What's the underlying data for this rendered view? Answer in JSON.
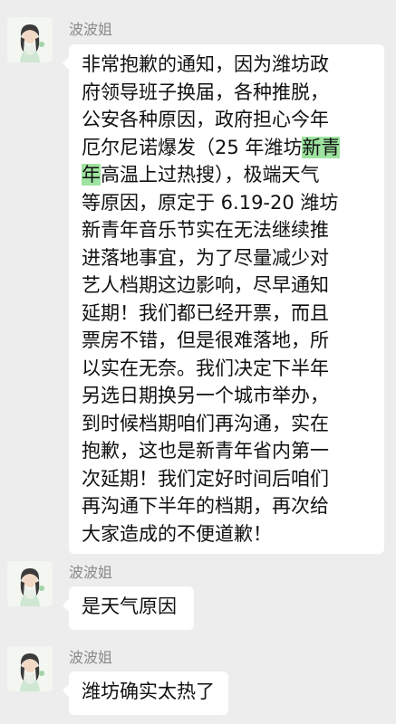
{
  "messages": [
    {
      "sender": "波波姐",
      "lines": [
        [
          "非常抱歉的通知，因为潍坊政"
        ],
        [
          "府领导班子换届，各种推脱，"
        ],
        [
          "公安各种原因，政府担心今年"
        ],
        [
          "厄尔尼诺爆发（25 年潍坊",
          "新青",
          ""
        ],
        [
          "",
          "年",
          "高温上过热搜），极端天气"
        ],
        [
          "等原因，原定于 6.19-20 潍坊"
        ],
        [
          "新青年音乐节实在无法继续推"
        ],
        [
          "进落地事宜，为了尽量减少对"
        ],
        [
          "艺人档期这边影响，尽早通知"
        ],
        [
          "延期！我们都已经开票，而且"
        ],
        [
          "票房不错，但是很难落地，所"
        ],
        [
          "以实在无奈。我们决定下半年"
        ],
        [
          "另选日期换另一个城市举办，"
        ],
        [
          "到时候档期咱们再沟通，实在"
        ],
        [
          "抱歉，这也是新青年省内第一"
        ],
        [
          "次延期！我们定好时间后咱们"
        ],
        [
          "再沟通下半年的档期，再次给"
        ],
        [
          "大家造成的不便道歉！"
        ]
      ]
    },
    {
      "sender": "波波姐",
      "text": "是天气原因"
    },
    {
      "sender": "波波姐",
      "text": "潍坊确实太热了"
    }
  ],
  "colors": {
    "background": "#ededed",
    "bubble": "#ffffff",
    "highlight": "#9ee3a0",
    "sender": "#8a8a8a"
  }
}
